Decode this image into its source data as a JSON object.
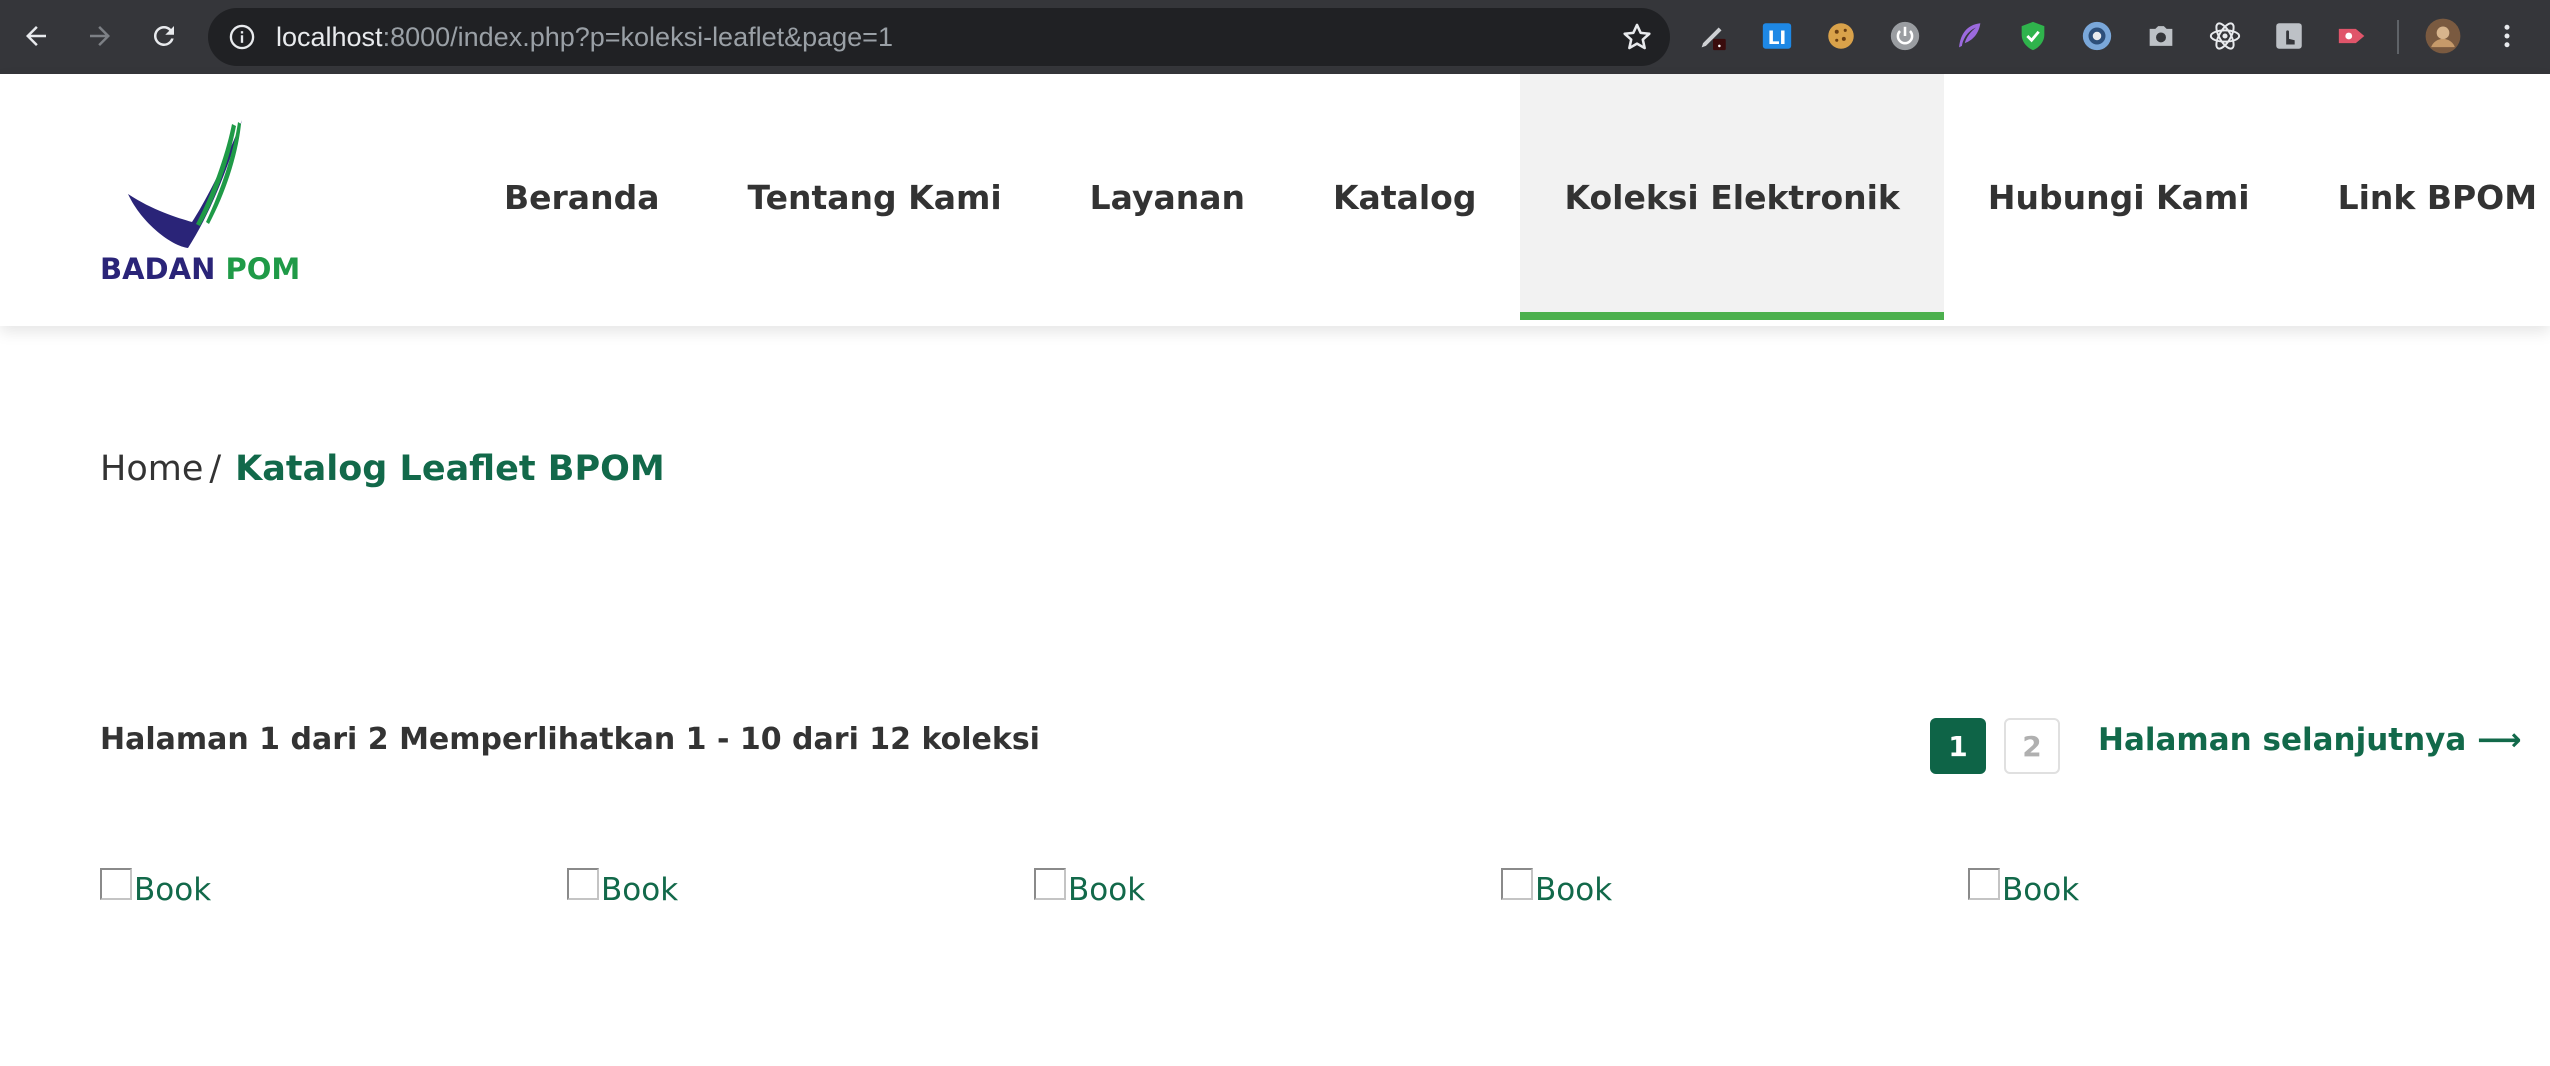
{
  "browser": {
    "url_host": "localhost",
    "url_rest": ":8000/index.php?p=koleksi-leaflet&page=1",
    "extensions": [
      "pen-icon",
      "li-icon",
      "cookie-icon",
      "power-icon",
      "feather-icon",
      "shield-icon",
      "circle-icon",
      "camera-icon",
      "react-icon",
      "hand-icon",
      "record-icon"
    ]
  },
  "logo": {
    "word1": "BADAN",
    "word2": "POM",
    "colors": {
      "navy": "#2a2478",
      "green": "#1f9a47"
    }
  },
  "nav": {
    "items": [
      {
        "label": "Beranda"
      },
      {
        "label": "Tentang Kami"
      },
      {
        "label": "Layanan"
      },
      {
        "label": "Katalog"
      },
      {
        "label": "Koleksi Elektronik",
        "active": true
      },
      {
        "label": "Hubungi Kami"
      },
      {
        "label": "Link BPOM"
      }
    ],
    "active_color": "#4cb04e"
  },
  "breadcrumb": {
    "home": "Home",
    "separator": "/",
    "current": "Katalog Leaflet BPOM"
  },
  "pagination": {
    "info": "Halaman 1 dari 2 Memperlihatkan 1 - 10 dari 12 koleksi",
    "pages": [
      "1",
      "2"
    ],
    "current_page": "1",
    "next_label": "Halaman selanjutnya ⟶"
  },
  "books": [
    {
      "alt": "Book"
    },
    {
      "alt": "Book"
    },
    {
      "alt": "Book"
    },
    {
      "alt": "Book"
    },
    {
      "alt": "Book"
    }
  ],
  "theme": {
    "accent": "#12694a",
    "button": "#0e6447"
  }
}
